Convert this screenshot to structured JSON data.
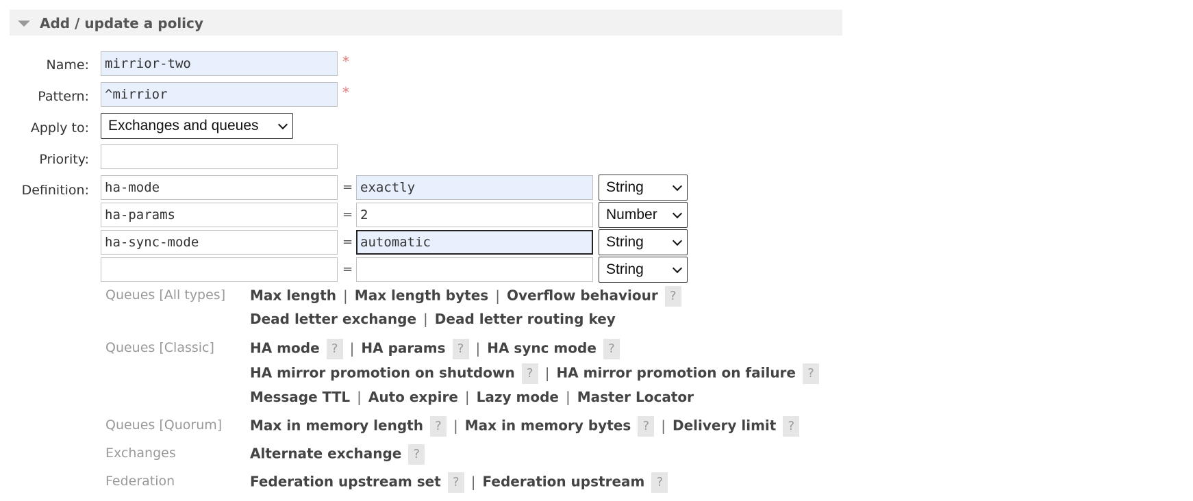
{
  "section": {
    "title": "Add / update a policy"
  },
  "form": {
    "name_label": "Name:",
    "name_value": "mirrior-two",
    "pattern_label": "Pattern:",
    "pattern_value": "^mirrior",
    "required_mark": "*",
    "apply_label": "Apply to:",
    "apply_value": "Exchanges and queues",
    "priority_label": "Priority:",
    "priority_value": "",
    "definition_label": "Definition:",
    "eq": "=",
    "definitions": [
      {
        "key": "ha-mode",
        "value": "exactly",
        "type": "String"
      },
      {
        "key": "ha-params",
        "value": "2",
        "type": "Number"
      },
      {
        "key": "ha-sync-mode",
        "value": "automatic",
        "type": "String"
      },
      {
        "key": "",
        "value": "",
        "type": "String"
      }
    ]
  },
  "help": {
    "q": "?",
    "sep": "|",
    "categories": {
      "all": "Queues [All types]",
      "classic": "Queues [Classic]",
      "quorum": "Queues [Quorum]",
      "exchanges": "Exchanges",
      "federation": "Federation"
    },
    "links": {
      "max_length": "Max length",
      "max_length_bytes": "Max length bytes",
      "overflow": "Overflow behaviour",
      "dlx": "Dead letter exchange",
      "dlrk": "Dead letter routing key",
      "ha_mode": "HA mode",
      "ha_params": "HA params",
      "ha_sync_mode": "HA sync mode",
      "ha_promo_shutdown": "HA mirror promotion on shutdown",
      "ha_promo_failure": "HA mirror promotion on failure",
      "message_ttl": "Message TTL",
      "auto_expire": "Auto expire",
      "lazy_mode": "Lazy mode",
      "master_locator": "Master Locator",
      "max_in_memory_length": "Max in memory length",
      "max_in_memory_bytes": "Max in memory bytes",
      "delivery_limit": "Delivery limit",
      "alternate_exchange": "Alternate exchange",
      "fed_upstream_set": "Federation upstream set",
      "fed_upstream": "Federation upstream"
    }
  }
}
